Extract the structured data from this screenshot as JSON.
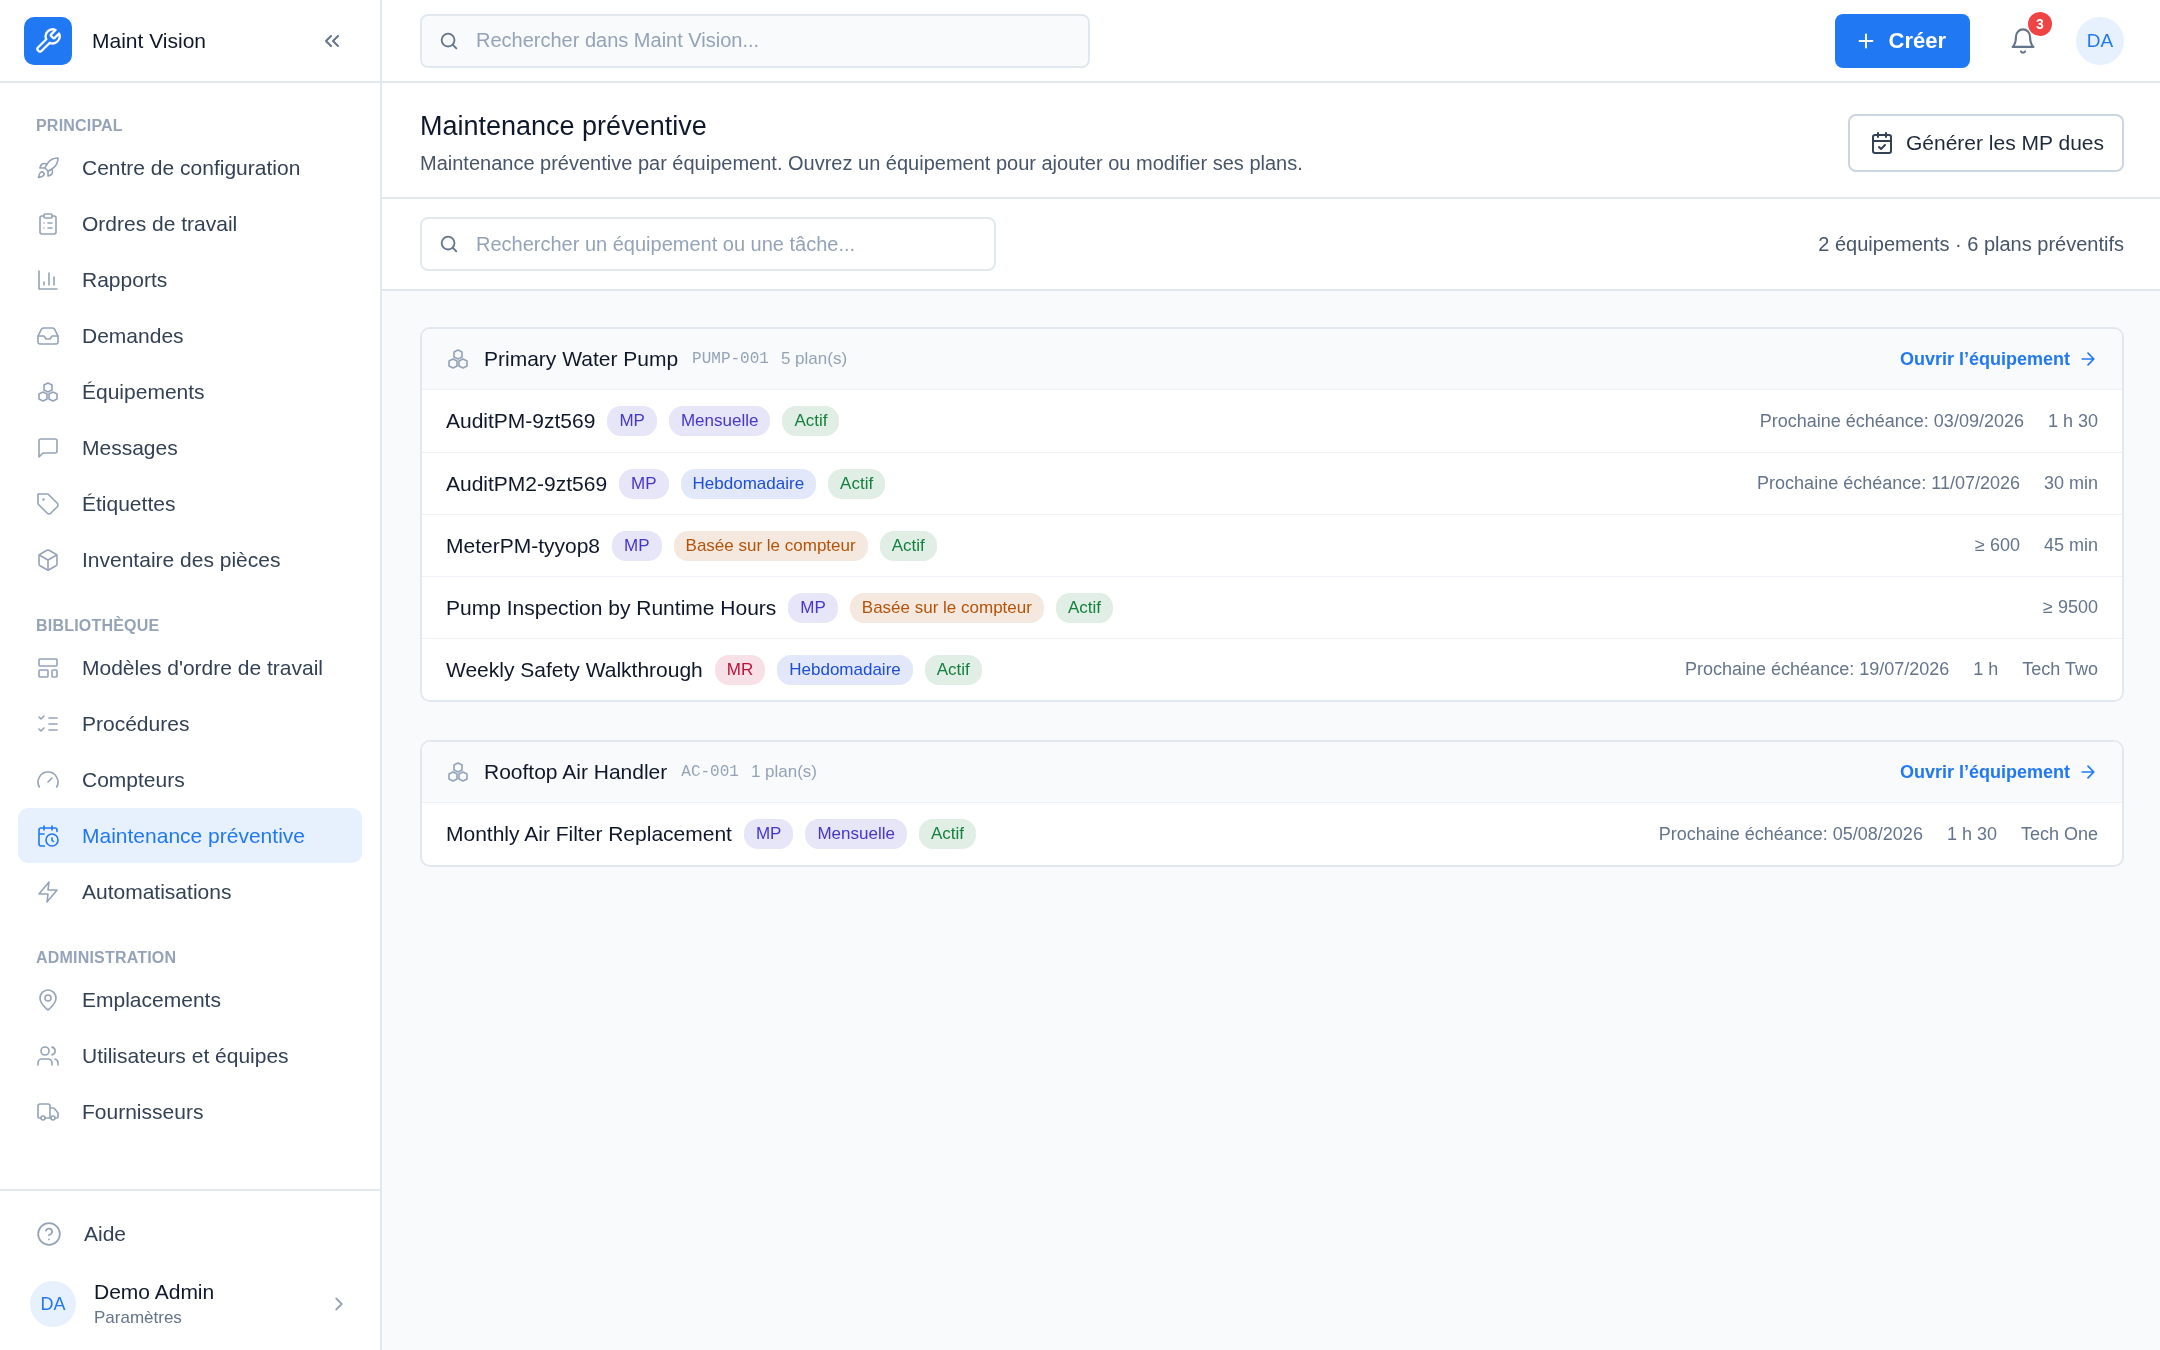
{
  "brand": {
    "name": "Maint Vision"
  },
  "sidebar": {
    "sections": [
      {
        "label": "PRINCIPAL",
        "items": [
          {
            "label": "Centre de configuration",
            "selected": false
          },
          {
            "label": "Ordres de travail",
            "selected": false
          },
          {
            "label": "Rapports",
            "selected": false
          },
          {
            "label": "Demandes",
            "selected": false
          },
          {
            "label": "Équipements",
            "selected": false
          },
          {
            "label": "Messages",
            "selected": false
          },
          {
            "label": "Étiquettes",
            "selected": false
          },
          {
            "label": "Inventaire des pièces",
            "selected": false
          }
        ]
      },
      {
        "label": "BIBLIOTHÈQUE",
        "items": [
          {
            "label": "Modèles d'ordre de travail",
            "selected": false
          },
          {
            "label": "Procédures",
            "selected": false
          },
          {
            "label": "Compteurs",
            "selected": false
          },
          {
            "label": "Maintenance préventive",
            "selected": true
          },
          {
            "label": "Automatisations",
            "selected": false
          }
        ]
      },
      {
        "label": "ADMINISTRATION",
        "items": [
          {
            "label": "Emplacements",
            "selected": false
          },
          {
            "label": "Utilisateurs et équipes",
            "selected": false
          },
          {
            "label": "Fournisseurs",
            "selected": false
          }
        ]
      }
    ],
    "help": "Aide",
    "user": {
      "initials": "DA",
      "name": "Demo Admin",
      "subtitle": "Paramètres"
    }
  },
  "topbar": {
    "search": {
      "placeholder": "Rechercher dans Maint Vision..."
    },
    "create_button": "Créer",
    "notifications": "3",
    "avatar": "DA"
  },
  "page": {
    "title": "Maintenance préventive",
    "subtitle": "Maintenance préventive par équipement. Ouvrez un équipement pour ajouter ou modifier ses plans.",
    "action_button": "Générer les MP dues"
  },
  "filter": {
    "search": {
      "placeholder": "Rechercher un équipement ou une tâche..."
    },
    "summary": "2 équipements · 6 plans préventifs"
  },
  "equipment": [
    {
      "name": "Primary Water Pump",
      "code": "PUMP-001",
      "count": "5 plan(s)",
      "link": "Ouvrir l’équipement",
      "plans": [
        {
          "name": "AuditPM-9zt569",
          "tags": [
            {
              "text": "MP",
              "color": "#4338ca"
            },
            {
              "text": "Mensuelle",
              "color": "#4338ca"
            },
            {
              "text": "Actif",
              "color": "#15803d"
            }
          ],
          "meta": [
            "Prochaine échéance: 03/09/2026",
            "1 h 30"
          ]
        },
        {
          "name": "AuditPM2-9zt569",
          "tags": [
            {
              "text": "MP",
              "color": "#4338ca"
            },
            {
              "text": "Hebdomadaire",
              "color": "#1d4ed8"
            },
            {
              "text": "Actif",
              "color": "#15803d"
            }
          ],
          "meta": [
            "Prochaine échéance: 11/07/2026",
            "30 min"
          ]
        },
        {
          "name": "MeterPM-tyyop8",
          "tags": [
            {
              "text": "MP",
              "color": "#4338ca"
            },
            {
              "text": "Basée sur le compteur",
              "color": "#b45309"
            },
            {
              "text": "Actif",
              "color": "#15803d"
            }
          ],
          "meta": [
            "≥ 600",
            "45 min"
          ]
        },
        {
          "name": "Pump Inspection by Runtime Hours",
          "tags": [
            {
              "text": "MP",
              "color": "#4338ca"
            },
            {
              "text": "Basée sur le compteur",
              "color": "#b45309"
            },
            {
              "text": "Actif",
              "color": "#15803d"
            }
          ],
          "meta": [
            "≥ 9500"
          ]
        },
        {
          "name": "Weekly Safety Walkthrough",
          "tags": [
            {
              "text": "MR",
              "color": "#be123c"
            },
            {
              "text": "Hebdomadaire",
              "color": "#1d4ed8"
            },
            {
              "text": "Actif",
              "color": "#15803d"
            }
          ],
          "meta": [
            "Prochaine échéance: 19/07/2026",
            "1 h",
            "Tech Two"
          ]
        }
      ]
    },
    {
      "name": "Rooftop Air Handler",
      "code": "AC-001",
      "count": "1 plan(s)",
      "link": "Ouvrir l’équipement",
      "plans": [
        {
          "name": "Monthly Air Filter Replacement",
          "tags": [
            {
              "text": "MP",
              "color": "#4338ca"
            },
            {
              "text": "Mensuelle",
              "color": "#4338ca"
            },
            {
              "text": "Actif",
              "color": "#15803d"
            }
          ],
          "meta": [
            "Prochaine échéance: 05/08/2026",
            "1 h 30",
            "Tech One"
          ]
        }
      ]
    }
  ]
}
